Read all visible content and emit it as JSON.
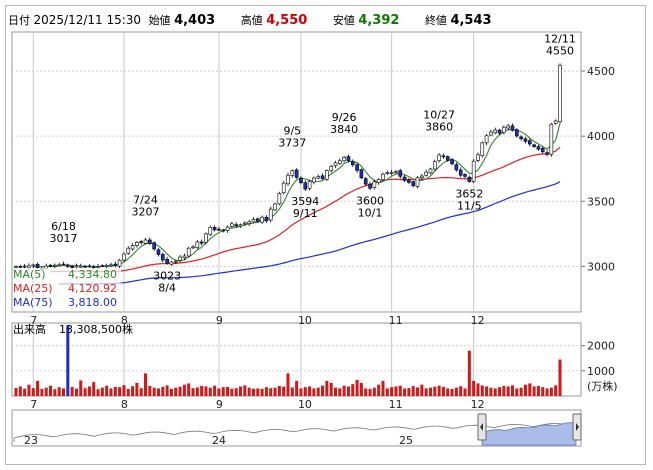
{
  "header": {
    "date_label": "日付",
    "datetime": "2025/12/11 15:30",
    "open_label": "始値",
    "open": "4,403",
    "high_label": "高値",
    "high": "4,550",
    "low_label": "安値",
    "low": "4,392",
    "close_label": "終値",
    "close": "4,543"
  },
  "colors": {
    "ma5": "#2f8a2f",
    "ma25": "#e02020",
    "ma75": "#1d2fd0",
    "up_candle": "#ffffff",
    "down_candle": "#1a2fbf",
    "volume": "#d41818",
    "spike_volume": "#1a2fbf",
    "navigator_fill": "#aabde8"
  },
  "chart_data": [
    {
      "type": "candlestick",
      "title": "",
      "y_ticks": [
        "3000",
        "3500",
        "4000",
        "4500"
      ],
      "ylim": [
        2650,
        4800
      ],
      "x_month_labels": [
        "7",
        "8",
        "9",
        "10",
        "11",
        "12"
      ],
      "ma_legend": [
        {
          "name": "MA(5)",
          "value": "4,334.80"
        },
        {
          "name": "MA(25)",
          "value": "4,120.92"
        },
        {
          "name": "MA(75)",
          "value": "3,818.00"
        }
      ],
      "annotations": [
        {
          "date": "6/18",
          "value": "3017"
        },
        {
          "date": "7/24",
          "value": "3207"
        },
        {
          "date": "8/4",
          "value": "3023"
        },
        {
          "date": "9/5",
          "value": "3737"
        },
        {
          "date": "9/11",
          "value": "3594"
        },
        {
          "date": "9/26",
          "value": "3840"
        },
        {
          "date": "10/1",
          "value": "3600"
        },
        {
          "date": "10/27",
          "value": "3860"
        },
        {
          "date": "11/5",
          "value": "3652"
        },
        {
          "date": "12/11",
          "value": "4550"
        }
      ],
      "x_index": [
        0,
        1,
        2,
        3,
        4,
        5,
        6,
        7,
        8,
        9,
        10,
        11,
        12,
        13,
        14,
        15,
        16,
        17,
        18,
        19,
        20,
        21,
        22,
        23,
        24,
        25,
        26,
        27,
        28,
        29,
        30,
        31,
        32,
        33,
        34,
        35,
        36,
        37,
        38,
        39,
        40,
        41,
        42,
        43,
        44,
        45,
        46,
        47,
        48,
        49,
        50,
        51,
        52,
        53,
        54,
        55,
        56,
        57,
        58,
        59,
        60,
        61,
        62,
        63,
        64,
        65,
        66,
        67,
        68,
        69,
        70,
        71,
        72,
        73,
        74,
        75,
        76,
        77,
        78,
        79,
        80,
        81,
        82,
        83,
        84,
        85,
        86,
        87,
        88,
        89,
        90,
        91,
        92,
        93,
        94,
        95,
        96,
        97,
        98,
        99,
        100,
        101,
        102,
        103,
        104,
        105,
        106,
        107,
        108,
        109,
        110,
        111,
        112,
        113,
        114,
        115,
        116,
        117,
        118,
        119,
        120,
        121,
        122,
        123,
        124,
        125,
        126
      ],
      "close": [
        3000,
        2997,
        2995,
        3004,
        3011,
        2990,
        2985,
        3003,
        3008,
        3010,
        3012,
        3017,
        3000,
        2990,
        3005,
        3002,
        2998,
        3002,
        2995,
        3000,
        3005,
        3008,
        3012,
        3008,
        3048,
        3095,
        3140,
        3160,
        3185,
        3183,
        3203,
        3176,
        3134,
        3092,
        3049,
        3023,
        3034,
        3040,
        3072,
        3080,
        3140,
        3150,
        3188,
        3178,
        3250,
        3300,
        3280,
        3285,
        3276,
        3302,
        3327,
        3310,
        3320,
        3334,
        3342,
        3360,
        3346,
        3378,
        3350,
        3440,
        3480,
        3560,
        3640,
        3700,
        3735,
        3683,
        3643,
        3594,
        3654,
        3678,
        3690,
        3675,
        3735,
        3768,
        3795,
        3811,
        3838,
        3812,
        3780,
        3737,
        3680,
        3632,
        3600,
        3650,
        3667,
        3708,
        3720,
        3722,
        3730,
        3692,
        3660,
        3645,
        3620,
        3681,
        3694,
        3724,
        3748,
        3806,
        3855,
        3843,
        3814,
        3788,
        3741,
        3700,
        3691,
        3652,
        3808,
        3857,
        3949,
        4003,
        4032,
        4047,
        4023,
        4069,
        4079,
        4045,
        4001,
        3980,
        3960,
        3940,
        3920,
        3900,
        3880,
        3860,
        4092,
        4117,
        4543
      ],
      "volume": [
        320,
        380,
        290,
        450,
        310,
        600,
        280,
        330,
        410,
        270,
        350,
        300,
        2800,
        360,
        290,
        620,
        310,
        380,
        550,
        270,
        330,
        410,
        300,
        360,
        350,
        430,
        280,
        390,
        520,
        310,
        900,
        400,
        330,
        300,
        360,
        420,
        280,
        330,
        370,
        450,
        500,
        310,
        340,
        400,
        380,
        330,
        410,
        300,
        350,
        360,
        290,
        310,
        380,
        420,
        330,
        290,
        300,
        280,
        350,
        310,
        330,
        400,
        370,
        900,
        340,
        600,
        300,
        350,
        380,
        300,
        330,
        410,
        600,
        520,
        330,
        300,
        410,
        380,
        470,
        640,
        520,
        300,
        280,
        330,
        450,
        600,
        300,
        350,
        380,
        410,
        300,
        320,
        390,
        340,
        450,
        300,
        330,
        370,
        410,
        360,
        300,
        280,
        330,
        390,
        300,
        1800,
        600,
        500,
        420,
        380,
        330,
        300,
        350,
        400,
        380,
        420,
        300,
        330,
        450,
        500,
        380,
        400,
        350,
        300,
        330,
        420,
        1450
      ],
      "volume_ticks": [
        "1000",
        "2000"
      ],
      "volume_unit": "(万株)",
      "volume_label": "出来高",
      "volume_value": "13,308,500株",
      "navigator_labels": [
        "23",
        "24",
        "25"
      ]
    }
  ]
}
